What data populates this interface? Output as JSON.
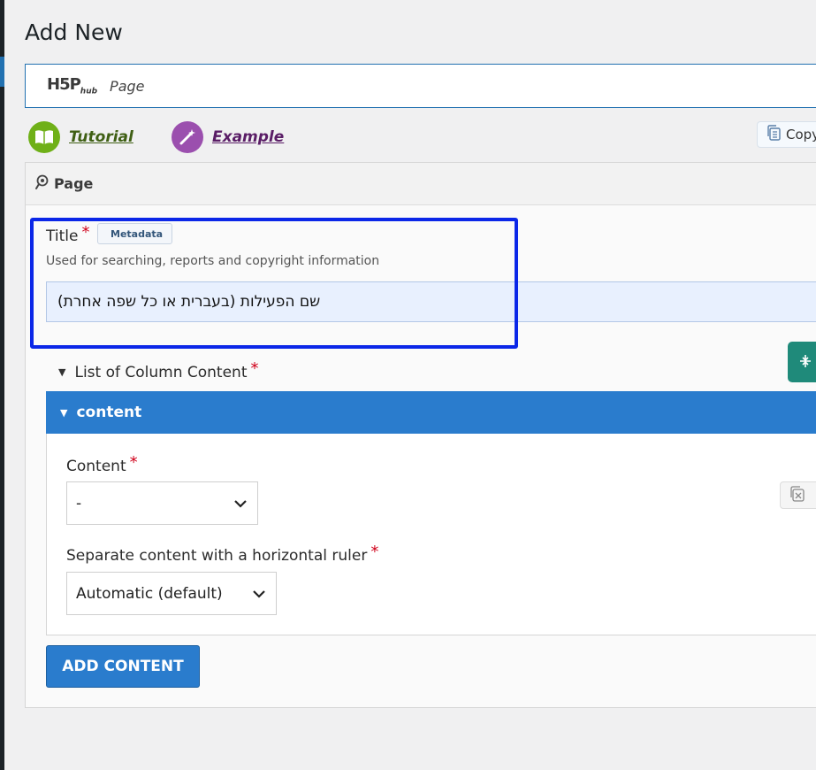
{
  "page": {
    "heading": "Add New"
  },
  "hub": {
    "logo_text": "H5P",
    "logo_sub": "hub",
    "content_type": "Page"
  },
  "help": {
    "tutorial_label": "Tutorial",
    "example_label": "Example",
    "copy_label": "Copy"
  },
  "editor": {
    "header_label": "Page",
    "title_field": {
      "label": "Title",
      "required_mark": "*",
      "metadata_label": "Metadata",
      "description": "Used for searching, reports and copyright information",
      "value": "שם הפעילות (בעברית או כל שפה אחרת)"
    },
    "list": {
      "label": "List of Column Content",
      "required_mark": "*"
    },
    "group": {
      "title": "content",
      "content_field": {
        "label": "Content",
        "required_mark": "*",
        "selected": "-"
      },
      "separator_field": {
        "label": "Separate content with a horizontal ruler",
        "required_mark": "*",
        "selected": "Automatic (default)"
      }
    },
    "add_button_label": "ADD CONTENT"
  },
  "colors": {
    "accent_blue": "#2a7ccd",
    "highlight_border": "#0b27e8",
    "teal": "#1f8a7a",
    "tutorial_green": "#6fb018",
    "example_purple": "#9b4fae",
    "required_red": "#d0021b"
  }
}
